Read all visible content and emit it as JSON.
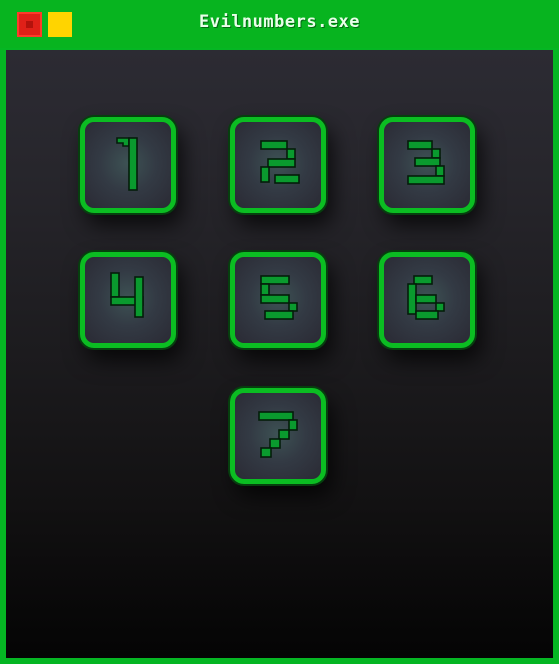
{
  "window": {
    "title": "Evilnumbers.exe",
    "close_button": "close-button",
    "minimize_button": "minimize-button"
  },
  "colors": {
    "frame": "#00b21e",
    "close": "#e02018",
    "minimize": "#ffd400",
    "key_border": "#0bbd22",
    "digit_fill": "#0a9a2e"
  },
  "keypad": {
    "keys": [
      {
        "label": "1"
      },
      {
        "label": "2"
      },
      {
        "label": "3"
      },
      {
        "label": "4"
      },
      {
        "label": "5"
      },
      {
        "label": "6"
      },
      {
        "label": "7"
      }
    ]
  }
}
